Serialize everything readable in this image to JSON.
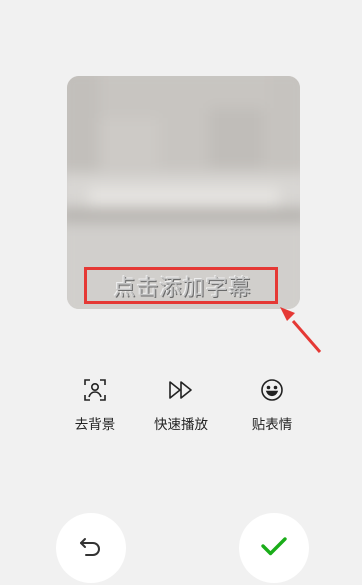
{
  "preview": {
    "subtitle_hint": "点击添加字幕"
  },
  "tools": [
    {
      "label": "去背景",
      "icon": "portrait-frame-icon"
    },
    {
      "label": "快速播放",
      "icon": "fast-forward-icon"
    },
    {
      "label": "贴表情",
      "icon": "smiley-icon"
    }
  ],
  "actions": {
    "undo_icon": "undo-icon",
    "confirm_icon": "checkmark-icon"
  },
  "colors": {
    "background": "#f1f1f1",
    "highlight": "#e53935",
    "confirm": "#1aad19"
  }
}
